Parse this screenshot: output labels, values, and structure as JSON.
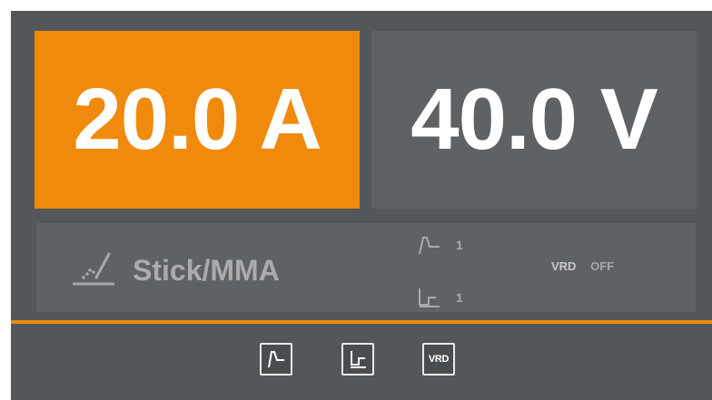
{
  "display": {
    "current": "20.0 A",
    "voltage": "40.0 V"
  },
  "status": {
    "mode_icon": "stick-welding-icon",
    "mode_label": "Stick/MMA",
    "hot_start": {
      "icon": "hot-start-icon",
      "value": "1"
    },
    "arc_force": {
      "icon": "arc-force-icon",
      "value": "1"
    },
    "vrd_label": "VRD",
    "vrd_state": "OFF"
  },
  "buttons": {
    "hot_start_icon": "hot-start-icon",
    "arc_force_icon": "arc-force-icon",
    "vrd_label": "VRD"
  },
  "colors": {
    "accent": "#f08a0c",
    "panel": "#5f6265",
    "background": "#53575a",
    "text": "#ffffff",
    "muted_text": "#a7a9ab"
  }
}
